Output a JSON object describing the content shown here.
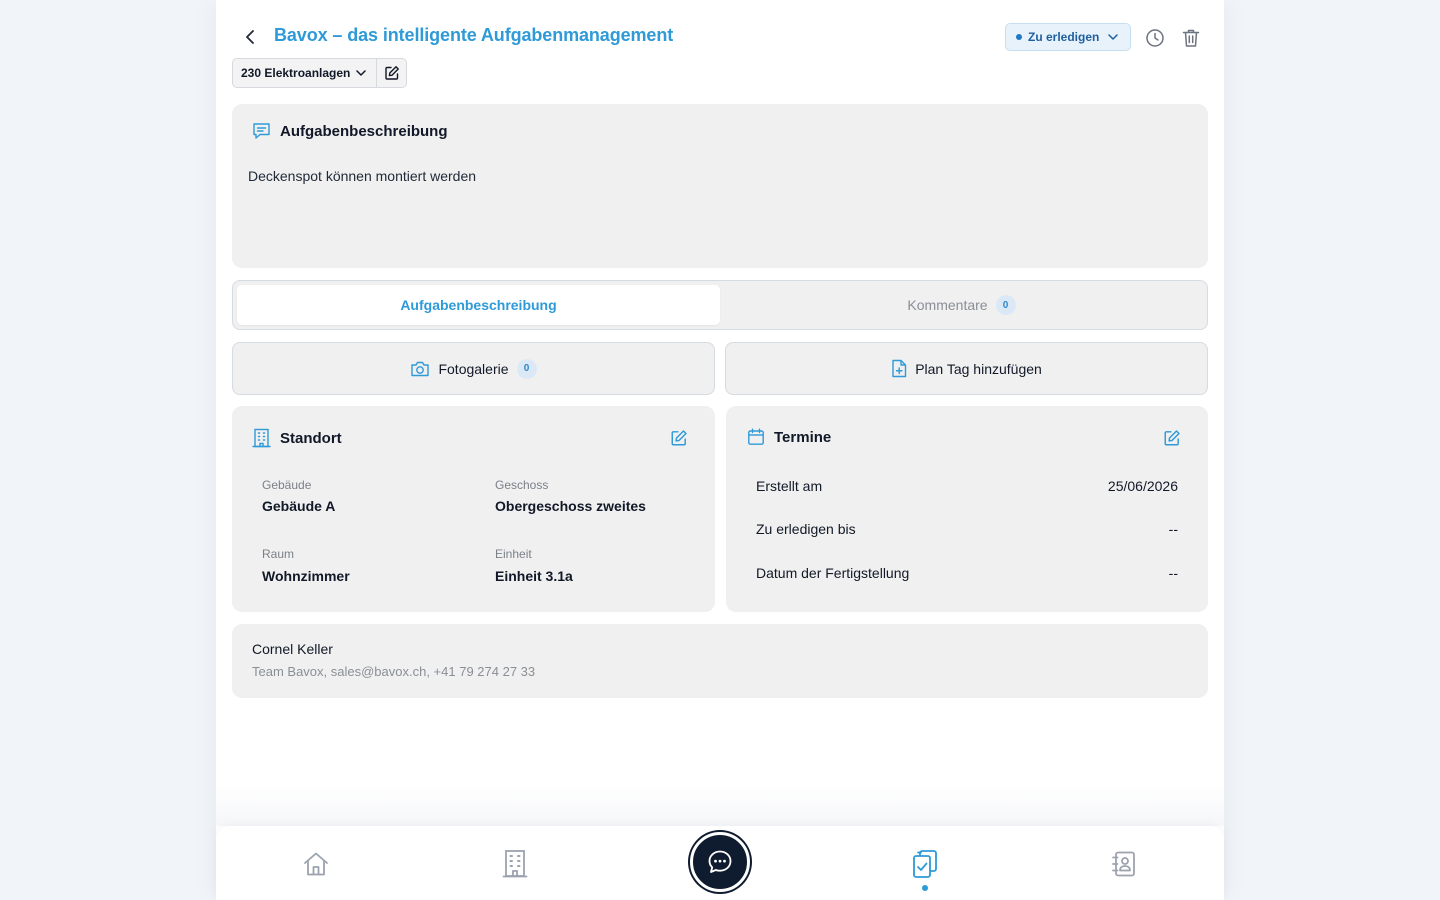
{
  "header": {
    "title": "Bavox – das intelligente Aufgabenmanagement",
    "status": "Zu erledigen",
    "category": "230 Elektroanlagen"
  },
  "description": {
    "heading": "Aufgabenbeschreibung",
    "text": "Deckenspot können montiert werden"
  },
  "tabs": [
    {
      "label": "Aufgabenbeschreibung"
    },
    {
      "label": "Kommentare",
      "count": "0"
    }
  ],
  "actions": {
    "photo_gallery": "Fotogalerie",
    "photo_count": "0",
    "add_plan_tag": "Plan Tag hinzufügen"
  },
  "location": {
    "heading": "Standort",
    "building_label": "Gebäude",
    "building_value": "Gebäude A",
    "floor_label": "Geschoss",
    "floor_value": "Obergeschoss zweites",
    "room_label": "Raum",
    "room_value": "Wohnzimmer",
    "unit_label": "Einheit",
    "unit_value": "Einheit 3.1a"
  },
  "dates": {
    "heading": "Termine",
    "rows": [
      {
        "label": "Erstellt am",
        "value": "25/06/2026"
      },
      {
        "label": "Zu erledigen bis",
        "value": "--"
      },
      {
        "label": "Datum der Fertigstellung",
        "value": "--"
      }
    ]
  },
  "contact": {
    "name": "Cornel Keller",
    "info": "Team Bavox, sales@bavox.ch, +41 79 274 27 33"
  },
  "nav": {
    "items": [
      "home-icon",
      "building-icon",
      "chat-icon",
      "tasks-icon",
      "contacts-icon"
    ],
    "active": "tasks"
  },
  "colors": {
    "accent": "#2e9ad8",
    "card": "#f0f0f0",
    "fab": "#0f1b2e",
    "status_bg": "#e8f2fb"
  }
}
